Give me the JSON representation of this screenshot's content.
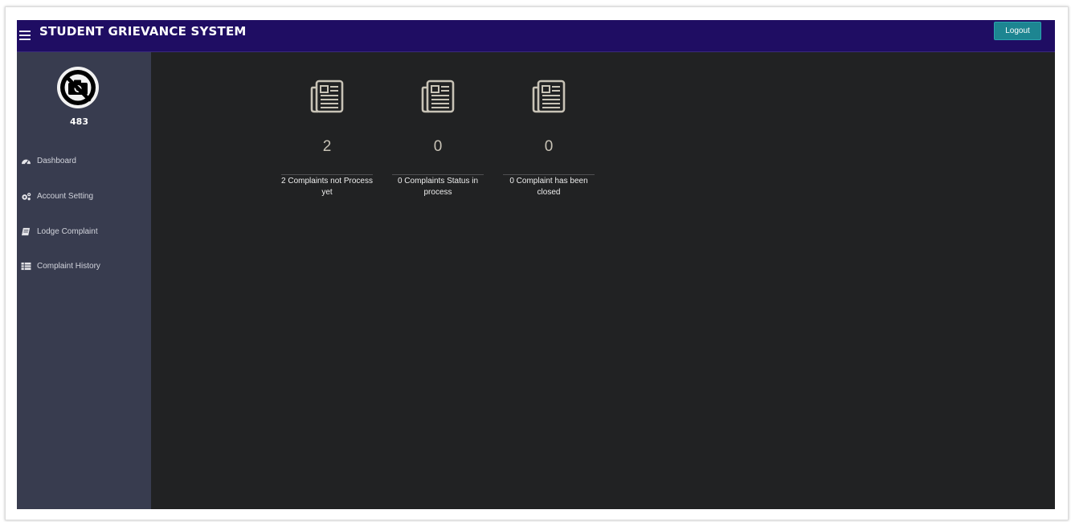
{
  "header": {
    "title": "STUDENT GRIEVANCE SYSTEM",
    "logout_label": "Logout",
    "menu_icon": "hamburger-menu-icon"
  },
  "sidebar": {
    "user_id": "483",
    "avatar_icon": "no-photo-icon",
    "items": [
      {
        "label": "Dashboard",
        "icon": "dashboard-gauge-icon"
      },
      {
        "label": "Account Setting",
        "icon": "cogs-icon"
      },
      {
        "label": "Lodge Complaint",
        "icon": "book-icon"
      },
      {
        "label": "Complaint History",
        "icon": "list-table-icon"
      }
    ]
  },
  "stats": [
    {
      "count": "2",
      "label": "2 Complaints not Process yet",
      "icon": "newspaper-icon"
    },
    {
      "count": "0",
      "label": "0 Complaints Status in process",
      "icon": "newspaper-icon"
    },
    {
      "count": "0",
      "label": "0 Complaint has been closed",
      "icon": "newspaper-icon"
    }
  ],
  "colors": {
    "topbar": "#1f0d63",
    "sidebar": "#383c4f",
    "content": "#212223",
    "logout_button": "#1d8591",
    "stat_icon": "#c8c3b6"
  }
}
